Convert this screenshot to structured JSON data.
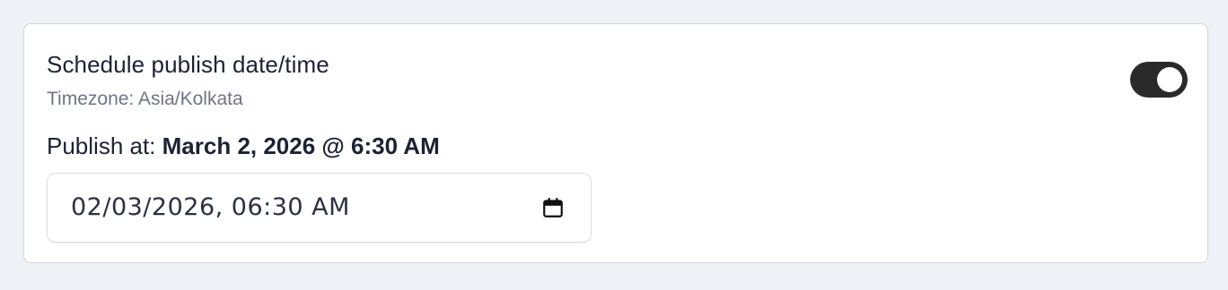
{
  "schedule": {
    "title": "Schedule publish date/time",
    "timezone": "Timezone: Asia/Kolkata",
    "publish_label": "Publish at: ",
    "publish_value": "March 2, 2026 @ 6:30 AM",
    "toggle_on": true,
    "input_value": "02/03/2026, 06:30 AM",
    "input_icon": "calendar-icon"
  },
  "colors": {
    "page_background": "#f0f1f6",
    "card_border": "#cfd3e6",
    "text_primary": "#1b2233",
    "text_secondary": "#6f7585",
    "toggle_on": "#2a2a2a"
  }
}
